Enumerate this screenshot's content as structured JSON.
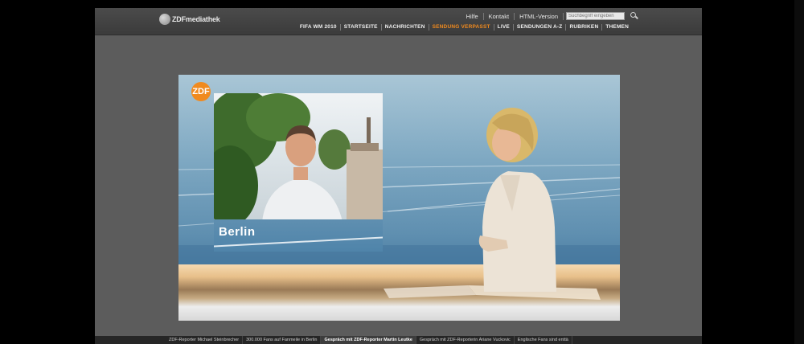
{
  "header": {
    "logo_text": "ZDFmediathek",
    "utility_links": [
      "Hilfe",
      "Kontakt",
      "HTML-Version"
    ],
    "search_placeholder": "Suchbegriff eingeben"
  },
  "nav": {
    "items": [
      {
        "label": "FIFA WM 2010",
        "active": false
      },
      {
        "label": "STARTSEITE",
        "active": false
      },
      {
        "label": "NACHRICHTEN",
        "active": false
      },
      {
        "label": "SENDUNG VERPASST",
        "active": true
      },
      {
        "label": "LIVE",
        "active": false
      },
      {
        "label": "SENDUNGEN A-Z",
        "active": false
      },
      {
        "label": "RUBRIKEN",
        "active": false
      },
      {
        "label": "THEMEN",
        "active": false
      }
    ],
    "active_color": "#f08a1e"
  },
  "player": {
    "channel_logo": "ZDF",
    "caption": "Berlin"
  },
  "related_videos": [
    {
      "label": "ZDF-Reporter Michael Steinbrecher",
      "active": false
    },
    {
      "label": "300.000 Fans auf Fanmeile in Berlin",
      "active": false
    },
    {
      "label": "Gespräch mit ZDF-Reporter Martin Leutke",
      "active": true
    },
    {
      "label": "Gespräch mit ZDF-Reporterin Ariane Vuckovic",
      "active": false
    },
    {
      "label": "Englische Fans sind enttä",
      "active": false
    }
  ],
  "icons": [
    "search-icon",
    "zdf-logo-icon",
    "mediathek-logo-icon"
  ]
}
